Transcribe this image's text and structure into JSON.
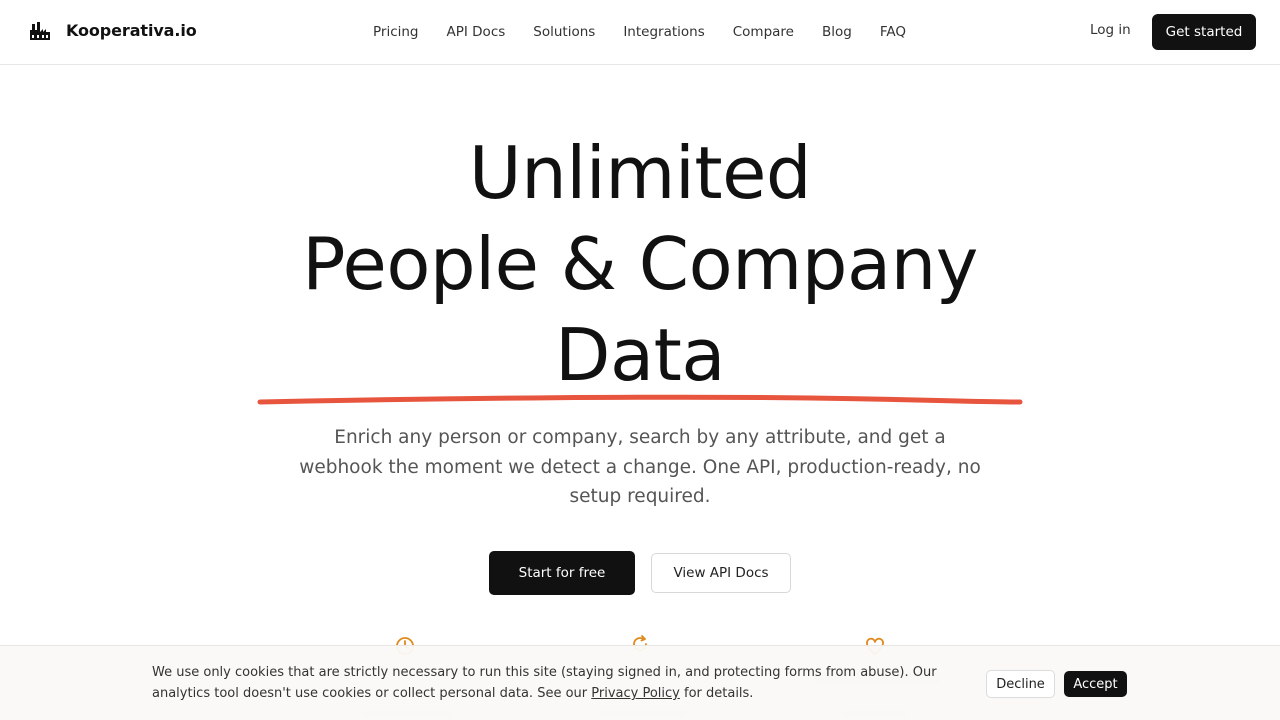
{
  "brand": {
    "name": "Kooperativa.io",
    "logo_icon": "factory-icon"
  },
  "nav": {
    "items": [
      "Pricing",
      "API Docs",
      "Solutions",
      "Integrations",
      "Compare",
      "Blog",
      "FAQ"
    ]
  },
  "header_actions": {
    "login": "Log in",
    "get_started": "Get started"
  },
  "hero": {
    "title_line1": "Unlimited",
    "title_line2": "People & Company",
    "title_line3": "Data",
    "subtitle": "Enrich any person or company, search by any attribute, and get a webhook the moment we detect a change. One API, production-ready, no setup required.",
    "primary_cta": "Start for free",
    "secondary_cta": "View API Docs",
    "underline_color": "#e8553e"
  },
  "features": {
    "icons": [
      "clock-icon",
      "refresh-icon",
      "heart-icon"
    ],
    "icon_color": "#e08a1e"
  },
  "cookie_banner": {
    "text_before_link": "We use only cookies that are strictly necessary to run this site (staying signed in, and protecting forms from abuse). Our analytics tool doesn't use cookies or collect personal data. See our ",
    "link_text": "Privacy Policy",
    "text_after_link": " for details.",
    "decline": "Decline",
    "accept": "Accept"
  }
}
